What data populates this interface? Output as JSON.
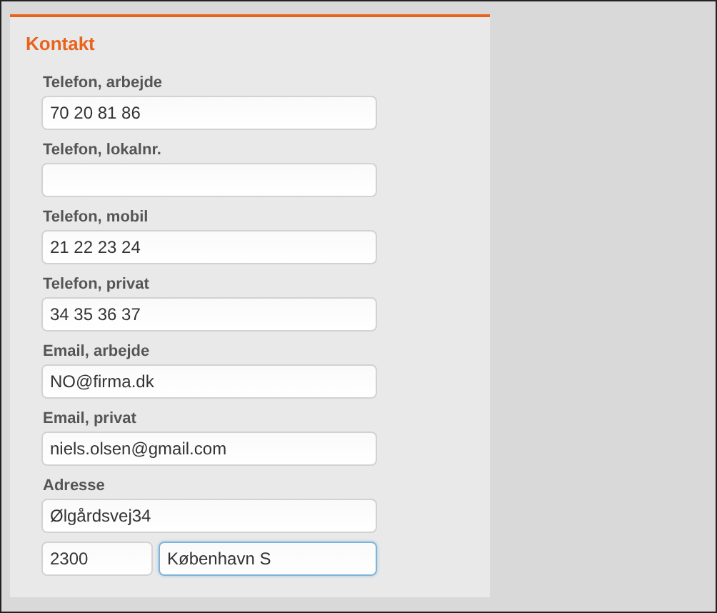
{
  "section": {
    "title": "Kontakt"
  },
  "fields": [
    {
      "label": "Telefon, arbejde",
      "inputs": [
        {
          "kind": "full",
          "value": "70 20 81 86",
          "focused": false
        }
      ]
    },
    {
      "label": "Telefon, lokalnr.",
      "inputs": [
        {
          "kind": "full",
          "focused": false
        }
      ]
    },
    {
      "label": "Telefon, mobil",
      "inputs": [
        {
          "kind": "full",
          "value": "21 22 23 24",
          "focused": false
        }
      ]
    },
    {
      "label": "Telefon, privat",
      "inputs": [
        {
          "kind": "full",
          "value": "34 35 36 37",
          "focused": false
        }
      ]
    },
    {
      "label": "Email, arbejde",
      "inputs": [
        {
          "kind": "full",
          "value": "NO@firma.dk",
          "focused": false
        }
      ]
    },
    {
      "label": "Email, privat",
      "inputs": [
        {
          "kind": "full",
          "value": "niels.olsen@gmail.com",
          "focused": false
        }
      ]
    },
    {
      "label": "Adresse",
      "inputs": [
        {
          "kind": "full",
          "value": "Ølgårdsvej34",
          "focused": false
        },
        {
          "kind": "postcode",
          "value": "2300",
          "focused": false
        },
        {
          "kind": "city",
          "value": "København S",
          "focused": true
        }
      ]
    }
  ]
}
